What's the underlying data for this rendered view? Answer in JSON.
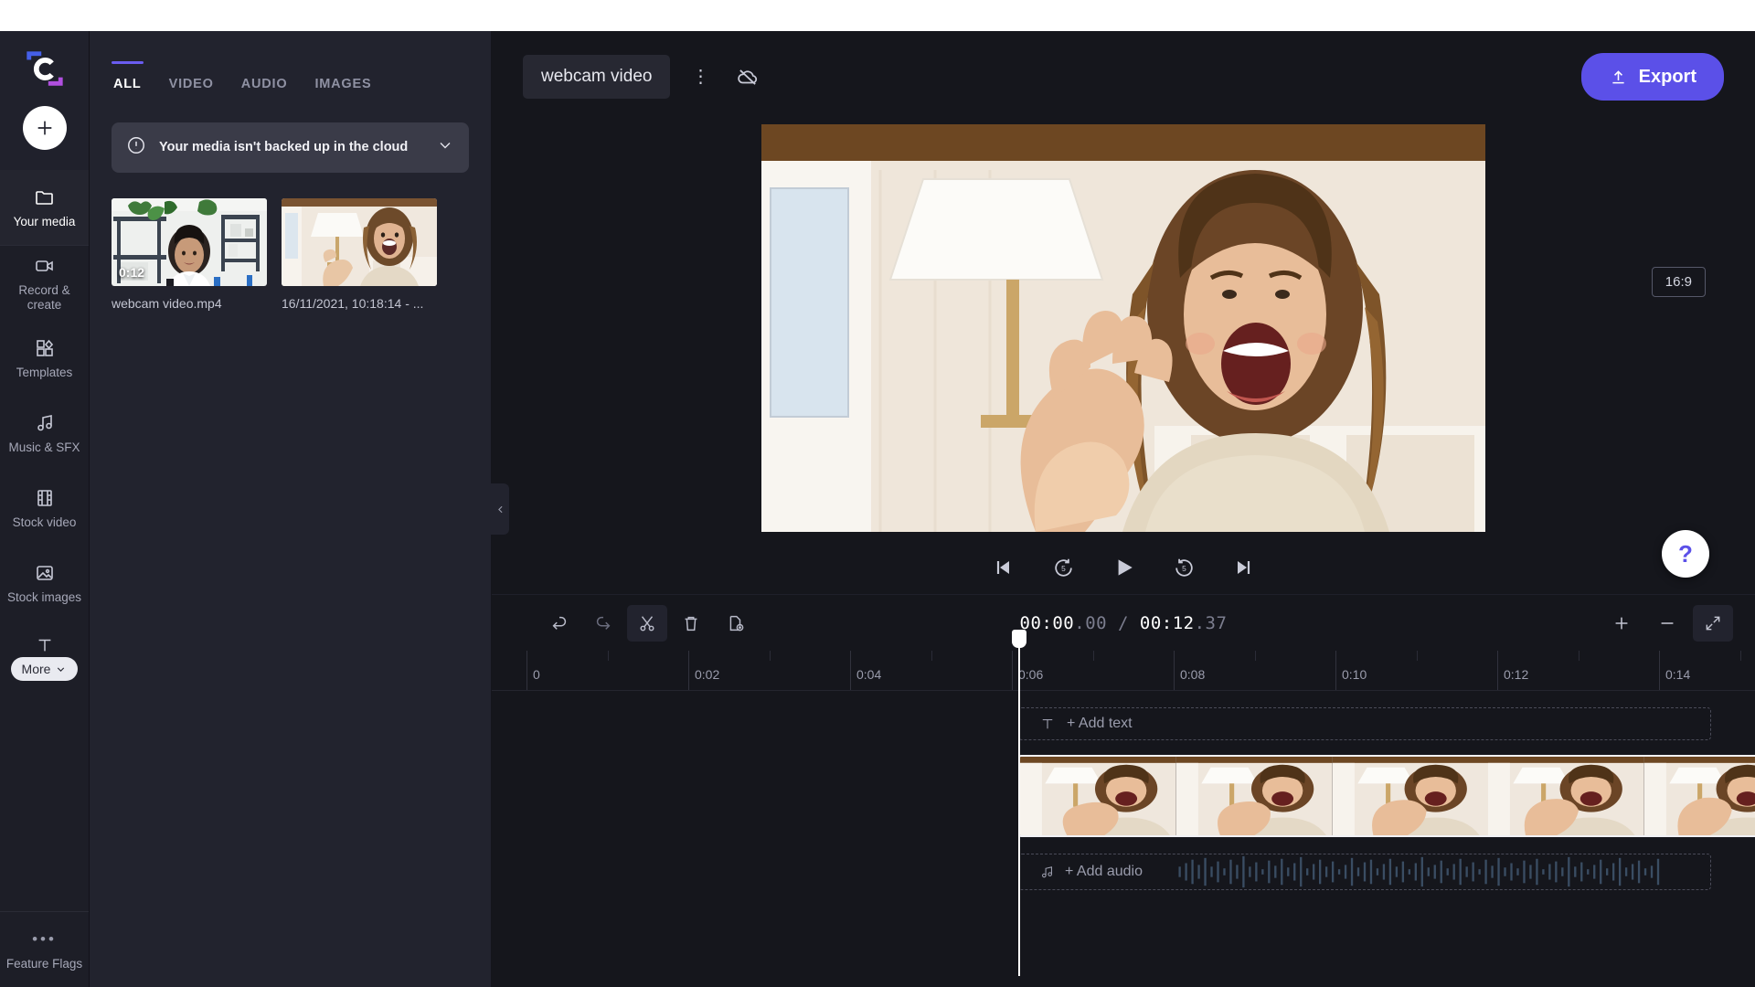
{
  "app": {
    "name": "Clipchamp",
    "accent_color": "#5b50e8",
    "background_color": "#15161c",
    "panel_color": "#22232e"
  },
  "rail": {
    "logo_name": "clipchamp-logo",
    "add_button_label": "+",
    "items": [
      {
        "id": "your-media",
        "label": "Your media",
        "icon": "folder-icon",
        "active": true
      },
      {
        "id": "record-create",
        "label": "Record & create",
        "icon": "video-camera-icon",
        "active": false
      },
      {
        "id": "templates",
        "label": "Templates",
        "icon": "templates-icon",
        "active": false
      },
      {
        "id": "music-sfx",
        "label": "Music & SFX",
        "icon": "music-note-icon",
        "active": false
      },
      {
        "id": "stock-video",
        "label": "Stock video",
        "icon": "film-strip-icon",
        "active": false
      },
      {
        "id": "stock-images",
        "label": "Stock images",
        "icon": "image-icon",
        "active": false
      },
      {
        "id": "text",
        "label": "",
        "icon": "text-icon",
        "active": false
      }
    ],
    "more_label": "More",
    "feature_flags_label": "Feature Flags",
    "feature_flags_icon": "ellipsis-icon"
  },
  "media_panel": {
    "tabs": [
      {
        "label": "ALL",
        "active": true
      },
      {
        "label": "VIDEO",
        "active": false
      },
      {
        "label": "AUDIO",
        "active": false
      },
      {
        "label": "IMAGES",
        "active": false
      }
    ],
    "banner": {
      "text": "Your media isn't backed up in the cloud",
      "icon": "alert-circle-icon",
      "chevron": "chevron-down-icon"
    },
    "items": [
      {
        "name": "webcam video.mp4",
        "duration": "0:12",
        "thumb": "woman-office-plants"
      },
      {
        "name": "16/11/2021, 10:18:14 - ...",
        "duration": "",
        "thumb": "woman-waving-lamp"
      }
    ],
    "collapse_icon": "chevron-left-icon"
  },
  "header": {
    "project_title": "webcam video",
    "menu_icon": "kebab-menu-icon",
    "cloud_icon": "cloud-off-icon",
    "export_label": "Export",
    "export_icon": "upload-icon"
  },
  "preview": {
    "aspect_ratio": "16:9",
    "help_label": "?",
    "transport": [
      {
        "id": "skip-start",
        "icon": "skip-to-start-icon"
      },
      {
        "id": "rewind-5",
        "icon": "rewind-5-icon",
        "seconds": "5"
      },
      {
        "id": "play",
        "icon": "play-icon"
      },
      {
        "id": "forward-5",
        "icon": "forward-5-icon",
        "seconds": "5"
      },
      {
        "id": "skip-end",
        "icon": "skip-to-end-icon"
      }
    ]
  },
  "timeline": {
    "tools": [
      {
        "id": "undo",
        "icon": "undo-icon",
        "enabled": true
      },
      {
        "id": "redo",
        "icon": "redo-icon",
        "enabled": false
      },
      {
        "id": "split",
        "icon": "scissors-icon",
        "enabled": true
      },
      {
        "id": "delete",
        "icon": "trash-icon",
        "enabled": true
      },
      {
        "id": "duplicate",
        "icon": "duplicate-icon",
        "enabled": true
      }
    ],
    "current_time": "00:00",
    "current_frames": ".00",
    "separator": " / ",
    "total_time": "00:12",
    "total_frames": ".37",
    "zoom_controls": [
      {
        "id": "zoom-in",
        "icon": "plus-icon"
      },
      {
        "id": "zoom-out",
        "icon": "minus-icon"
      },
      {
        "id": "fit",
        "icon": "fit-to-screen-icon"
      }
    ],
    "ruler_labels": [
      "0",
      "0:02",
      "0:04",
      "0:06",
      "0:08",
      "0:10",
      "0:12",
      "0:14"
    ],
    "add_text_label": "+ Add text",
    "add_text_icon": "text-icon",
    "add_audio_label": "+ Add audio",
    "add_audio_icon": "music-note-icon",
    "playhead_position": "0",
    "video_clip": {
      "name": "webcam video.mp4",
      "frames": 7
    }
  }
}
